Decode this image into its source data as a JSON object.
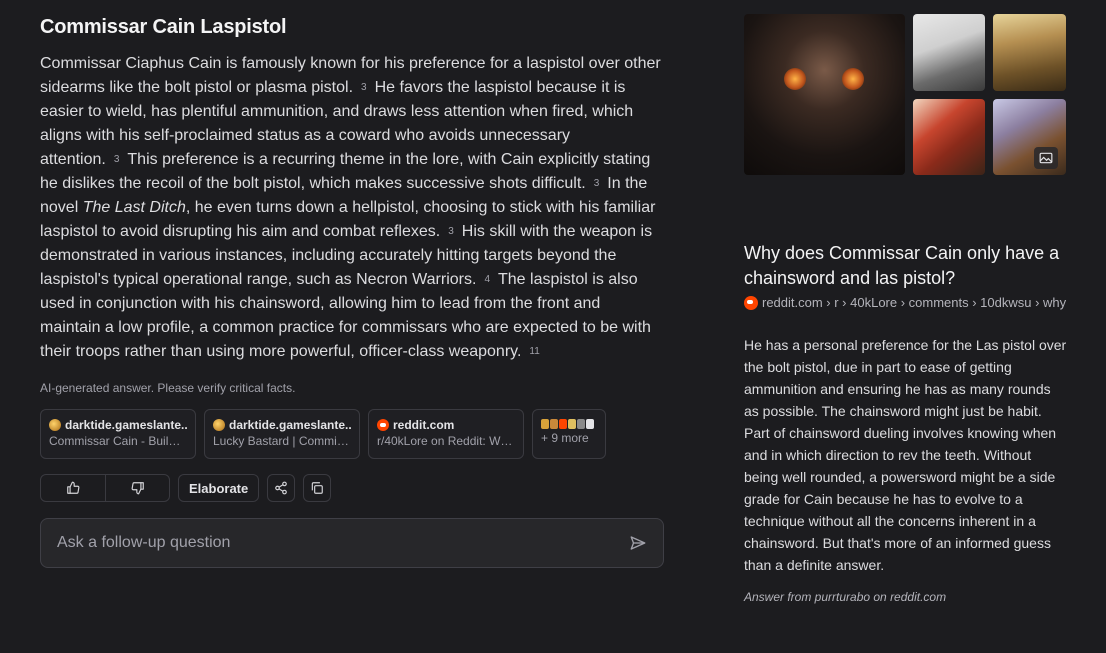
{
  "answer": {
    "title": "Commissar Cain Laspistol",
    "segments": [
      {
        "text": "Commissar Ciaphus Cain is famously known for his preference for a laspistol over other sidearms like the bolt pistol or plasma pistol.",
        "cite": "3"
      },
      {
        "text": "He favors the laspistol because it is easier to wield, has plentiful ammunition, and draws less attention when fired, which aligns with his self-proclaimed status as a coward who avoids unnecessary attention.",
        "cite": "3"
      },
      {
        "text": "This preference is a recurring theme in the lore, with Cain explicitly stating he dislikes the recoil of the bolt pistol, which makes successive shots difficult.",
        "cite": "3"
      },
      {
        "pre": "In the novel ",
        "em": "The Last Ditch",
        "post": ", he even turns down a hellpistol, choosing to stick with his familiar laspistol to avoid disrupting his aim and combat reflexes.",
        "cite": "3"
      },
      {
        "text": "His skill with the weapon is demonstrated in various instances, including accurately hitting targets beyond the laspistol's typical operational range, such as Necron Warriors.",
        "cite": "4"
      },
      {
        "text": "The laspistol is also used in conjunction with his chainsword, allowing him to lead from the front and maintain a low profile, a common practice for commissars who are expected to be with their troops rather than using more powerful, officer-class weaponry.",
        "cite": "11"
      }
    ],
    "disclaimer": "AI-generated answer. Please verify critical facts."
  },
  "sources": [
    {
      "site": "darktide.gameslante...",
      "desc": "Commissar Cain - Build ...",
      "icon": "gameslantern-icon"
    },
    {
      "site": "darktide.gameslante...",
      "desc": "Lucky Bastard | Commis...",
      "icon": "gameslantern-icon"
    },
    {
      "site": "reddit.com",
      "desc": "r/40kLore on Reddit: Wh...",
      "icon": "reddit-icon"
    }
  ],
  "more_sources": {
    "label": "+ 9 more"
  },
  "actions": {
    "elaborate": "Elaborate"
  },
  "followup": {
    "placeholder": "Ask a follow-up question"
  },
  "side": {
    "question_title": "Why does Commissar Cain only have a chainsword and las pistol?",
    "source_path": "reddit.com › r › 40kLore › comments › 10dkwsu › why",
    "body": "He has a personal preference for the Las pistol over the bolt pistol, due in part to ease of getting ammunition and ensuring he has as many rounds as possible. The chainsword might just be habit. Part of chainsword dueling involves knowing when and in which direction to rev the teeth. Without being well rounded, a powersword might be a side grade for Cain because he has to evolve to a technique without all the concerns inherent in a chainsword. But that's more of an informed guess than a definite answer.",
    "attribution": "Answer from purrturabo on reddit.com"
  },
  "colors": {
    "background": "#1c1c1f",
    "reddit": "#ff4500",
    "text": "#dcdcdf",
    "muted": "#a1a1aa"
  }
}
